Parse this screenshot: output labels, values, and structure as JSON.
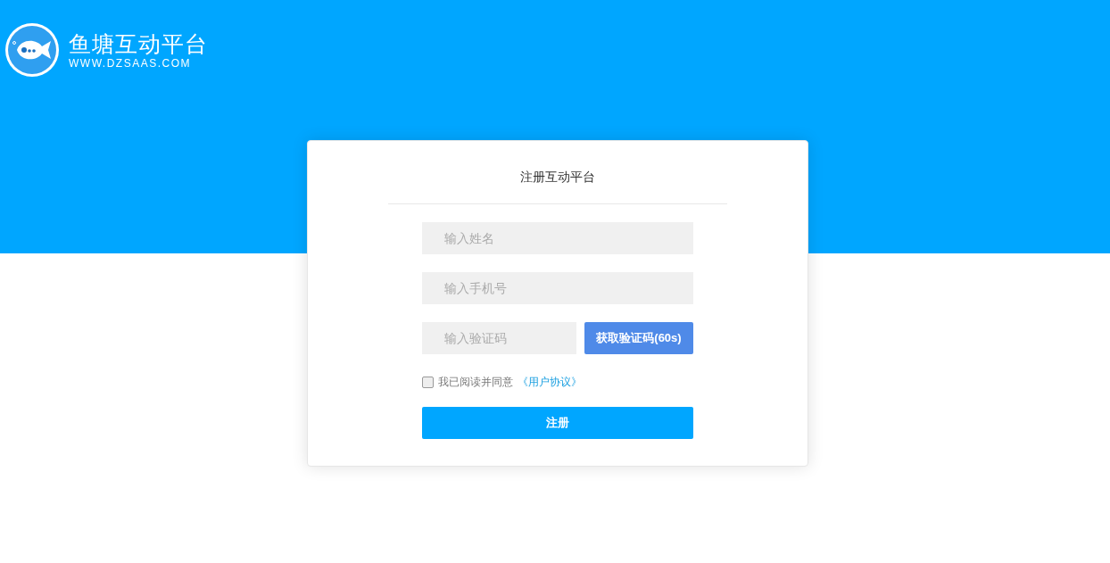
{
  "brand": {
    "name": "鱼塘互动平台",
    "url": "WWW.DZSAAS.COM"
  },
  "form": {
    "title": "注册互动平台",
    "fields": [
      {
        "kind": "text",
        "placeholder": "输入姓名"
      },
      {
        "kind": "text",
        "placeholder": "输入手机号"
      },
      {
        "kind": "code",
        "placeholder": "输入验证码",
        "button": "获取验证码(60s)"
      }
    ],
    "agreement": {
      "checked": false,
      "text": "我已阅读并同意",
      "link": "《用户协议》"
    },
    "submit": "注册"
  }
}
